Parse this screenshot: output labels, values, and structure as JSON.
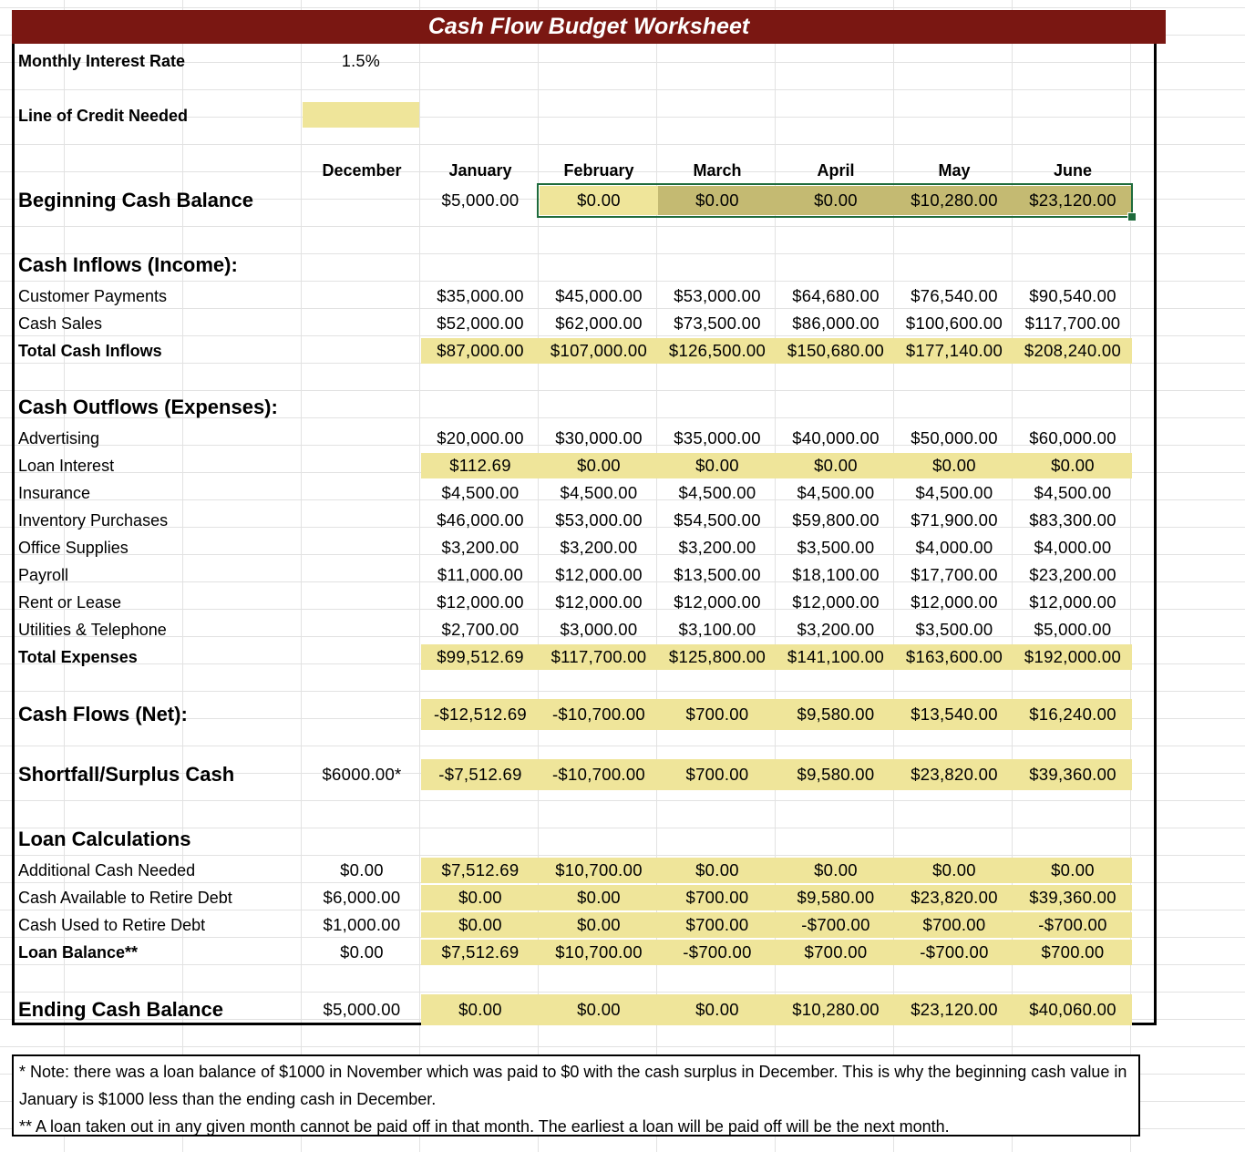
{
  "title": "Cash Flow Budget Worksheet",
  "interest": {
    "label": "Monthly Interest Rate",
    "value": "1.5%"
  },
  "credit": {
    "label": "Line of Credit Needed"
  },
  "months": [
    "December",
    "January",
    "February",
    "March",
    "April",
    "May",
    "June"
  ],
  "beginning": {
    "label": "Beginning Cash Balance",
    "values": [
      "",
      "$5,000.00",
      "$0.00",
      "$0.00",
      "$0.00",
      "$10,280.00",
      "$23,120.00"
    ]
  },
  "inflows": {
    "heading": "Cash Inflows (Income):",
    "rows": [
      {
        "label": "Customer Payments",
        "values": [
          "",
          "$35,000.00",
          "$45,000.00",
          "$53,000.00",
          "$64,680.00",
          "$76,540.00",
          "$90,540.00"
        ]
      },
      {
        "label": "Cash Sales",
        "values": [
          "",
          "$52,000.00",
          "$62,000.00",
          "$73,500.00",
          "$86,000.00",
          "$100,600.00",
          "$117,700.00"
        ]
      },
      {
        "label": "Total Cash Inflows",
        "values": [
          "",
          "$87,000.00",
          "$107,000.00",
          "$126,500.00",
          "$150,680.00",
          "$177,140.00",
          "$208,240.00"
        ]
      }
    ]
  },
  "outflows": {
    "heading": "Cash Outflows (Expenses):",
    "rows": [
      {
        "label": "Advertising",
        "values": [
          "",
          "$20,000.00",
          "$30,000.00",
          "$35,000.00",
          "$40,000.00",
          "$50,000.00",
          "$60,000.00"
        ]
      },
      {
        "label": "Loan Interest",
        "values": [
          "",
          "$112.69",
          "$0.00",
          "$0.00",
          "$0.00",
          "$0.00",
          "$0.00"
        ]
      },
      {
        "label": "Insurance",
        "values": [
          "",
          "$4,500.00",
          "$4,500.00",
          "$4,500.00",
          "$4,500.00",
          "$4,500.00",
          "$4,500.00"
        ]
      },
      {
        "label": "Inventory Purchases",
        "values": [
          "",
          "$46,000.00",
          "$53,000.00",
          "$54,500.00",
          "$59,800.00",
          "$71,900.00",
          "$83,300.00"
        ]
      },
      {
        "label": "Office Supplies",
        "values": [
          "",
          "$3,200.00",
          "$3,200.00",
          "$3,200.00",
          "$3,500.00",
          "$4,000.00",
          "$4,000.00"
        ]
      },
      {
        "label": "Payroll",
        "values": [
          "",
          "$11,000.00",
          "$12,000.00",
          "$13,500.00",
          "$18,100.00",
          "$17,700.00",
          "$23,200.00"
        ]
      },
      {
        "label": "Rent or Lease",
        "values": [
          "",
          "$12,000.00",
          "$12,000.00",
          "$12,000.00",
          "$12,000.00",
          "$12,000.00",
          "$12,000.00"
        ]
      },
      {
        "label": "Utilities & Telephone",
        "values": [
          "",
          "$2,700.00",
          "$3,000.00",
          "$3,100.00",
          "$3,200.00",
          "$3,500.00",
          "$5,000.00"
        ]
      },
      {
        "label": "Total Expenses",
        "values": [
          "",
          "$99,512.69",
          "$117,700.00",
          "$125,800.00",
          "$141,100.00",
          "$163,600.00",
          "$192,000.00"
        ]
      }
    ]
  },
  "net": {
    "label": "Cash Flows (Net):",
    "values": [
      "",
      "-$12,512.69",
      "-$10,700.00",
      "$700.00",
      "$9,580.00",
      "$13,540.00",
      "$16,240.00"
    ]
  },
  "shortfall": {
    "label": "Shortfall/Surplus Cash",
    "values": [
      "$6000.00*",
      "-$7,512.69",
      "-$10,700.00",
      "$700.00",
      "$9,580.00",
      "$23,820.00",
      "$39,360.00"
    ]
  },
  "loan": {
    "heading": "Loan Calculations",
    "rows": [
      {
        "label": "Additional Cash Needed",
        "values": [
          "$0.00",
          "$7,512.69",
          "$10,700.00",
          "$0.00",
          "$0.00",
          "$0.00",
          "$0.00"
        ]
      },
      {
        "label": "Cash Available to Retire Debt",
        "values": [
          "$6,000.00",
          "$0.00",
          "$0.00",
          "$700.00",
          "$9,580.00",
          "$23,820.00",
          "$39,360.00"
        ]
      },
      {
        "label": "Cash Used to Retire Debt",
        "values": [
          "$1,000.00",
          "$0.00",
          "$0.00",
          "$700.00",
          "-$700.00",
          "$700.00",
          "-$700.00"
        ]
      },
      {
        "label": "Loan Balance**",
        "values": [
          "$0.00",
          "$7,512.69",
          "$10,700.00",
          "-$700.00",
          "$700.00",
          "-$700.00",
          "$700.00"
        ]
      }
    ]
  },
  "ending": {
    "label": "Ending Cash Balance",
    "values": [
      "$5,000.00",
      "$0.00",
      "$0.00",
      "$0.00",
      "$10,280.00",
      "$23,120.00",
      "$40,060.00"
    ]
  },
  "notes": {
    "note1": "* Note: there was a loan balance of $1000 in November which was paid to $0 with the cash surplus in December. This is why the beginning cash value in January is $1000 less than the ending cash in December.",
    "note2": "** A loan taken out in any given month cannot be paid off in that month. The earliest a loan will be paid off will be the next month."
  },
  "colors": {
    "title_bg": "#7a1712",
    "highlight": "#efe59a",
    "selected": "#c4ba72",
    "selection_border": "#1e6b3c"
  }
}
